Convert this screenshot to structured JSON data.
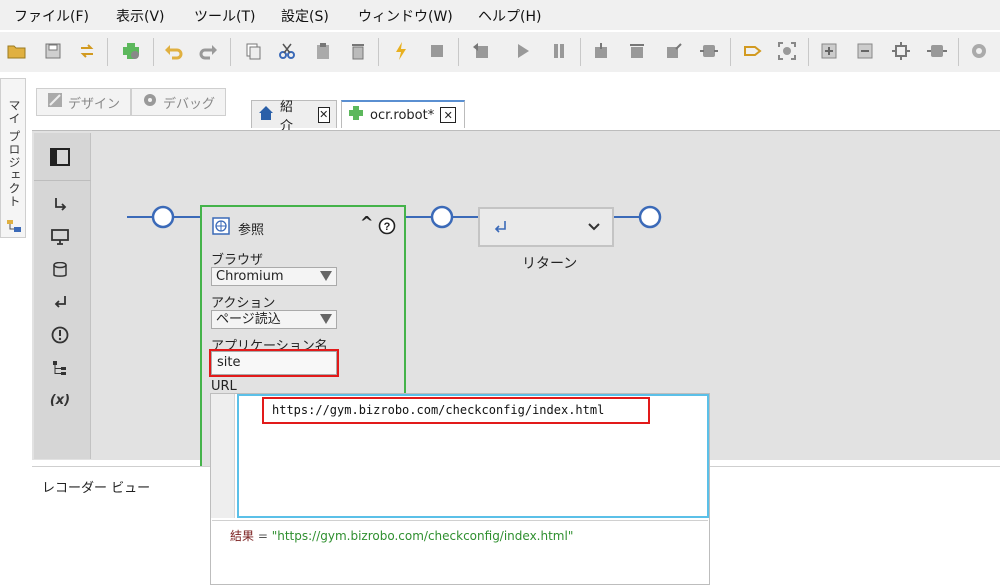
{
  "menu": {
    "items": [
      "ファイル(F)",
      "表示(V)",
      "ツール(T)",
      "設定(S)",
      "ウィンドウ(W)",
      "ヘルプ(H)"
    ]
  },
  "side": {
    "project_label": "マイ プロジェクト"
  },
  "modes": {
    "design": "デザイン",
    "debug": "デバッグ"
  },
  "tabs": {
    "intro": "紹介",
    "robot": "ocr.robot*"
  },
  "step": {
    "title": "参照",
    "browser_label": "ブラウザ",
    "browser_value": "Chromium",
    "action_label": "アクション",
    "action_value": "ページ読込",
    "app_name_label": "アプリケーション名",
    "app_name_value": "site",
    "url_label": "URL"
  },
  "return_step": {
    "label": "リターン"
  },
  "recorder": {
    "title": "レコーダー ビュー"
  },
  "url_editor": {
    "value": "https://gym.bizrobo.com/checkconfig/index.html",
    "result_key": "結果",
    "result_eq": " = ",
    "result_value": "\"https://gym.bizrobo.com/checkconfig/index.html\""
  },
  "colors": {
    "accent_blue": "#3b6ab8",
    "step_green": "#44b34a",
    "highlight_red": "#e21a1a",
    "editor_focus": "#5bc0e8"
  },
  "icons": [
    "open-folder-icon",
    "save-icon",
    "refresh-icon",
    "add-robot-icon",
    "undo-icon",
    "redo-icon",
    "copy-icon",
    "cut-icon",
    "paste-icon",
    "delete-icon",
    "run-icon",
    "stop-icon",
    "play-icon",
    "pause-icon",
    "home-icon",
    "help-icon",
    "return-icon",
    "browser-globe-icon"
  ]
}
